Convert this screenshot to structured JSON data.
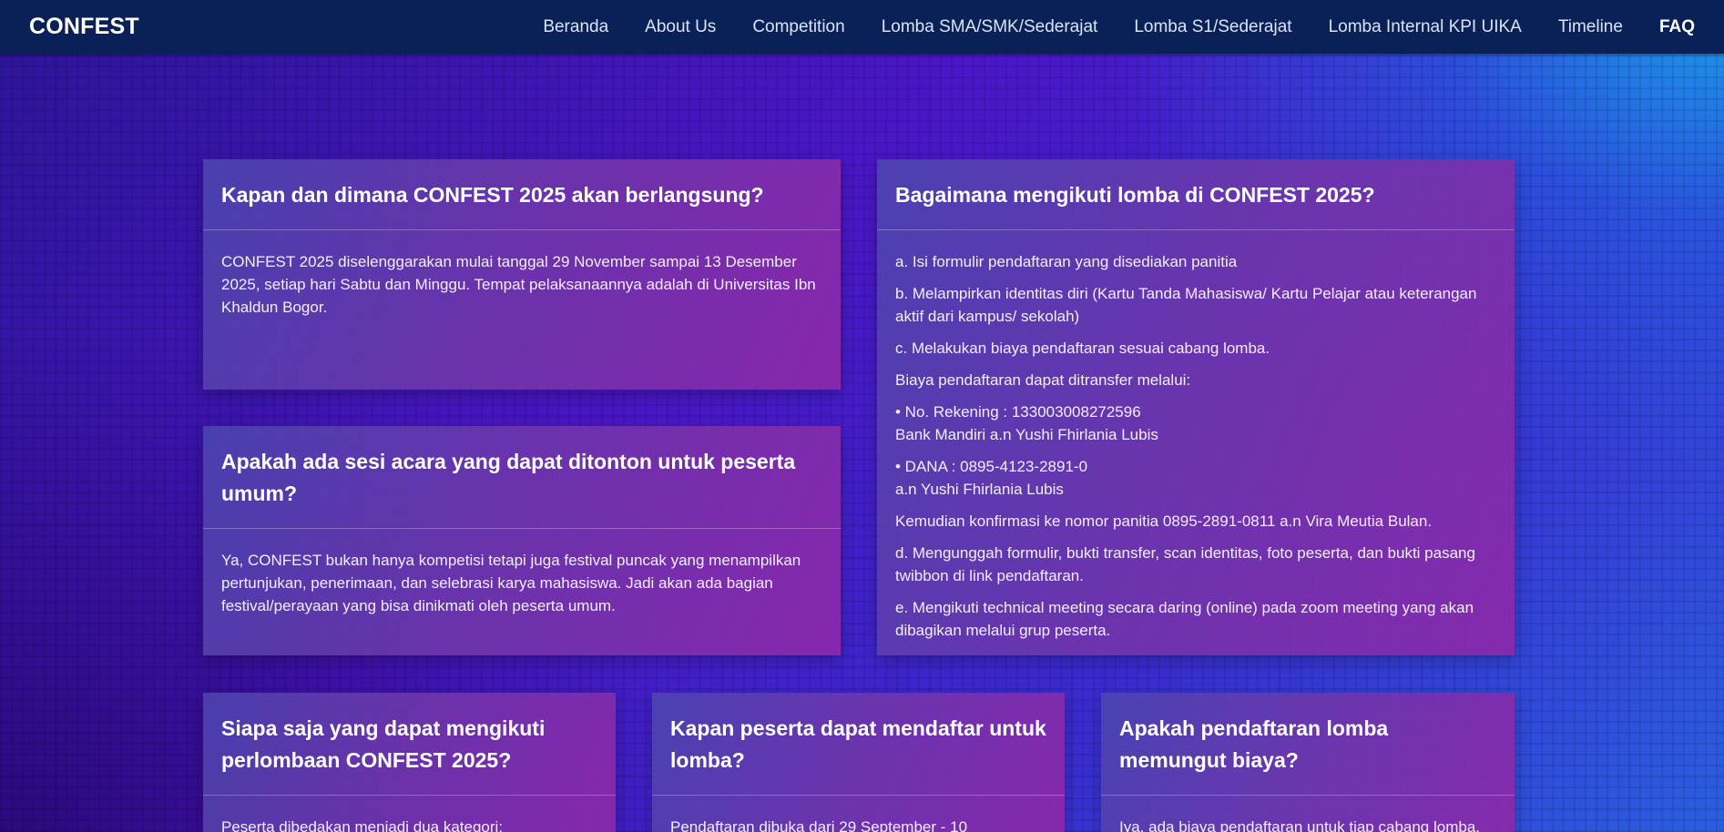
{
  "nav": {
    "brand": "CONFEST",
    "links": [
      "Beranda",
      "About Us",
      "Competition",
      "Lomba SMA/SMK/Sederajat",
      "Lomba S1/Sederajat",
      "Lomba Internal KPI UIKA",
      "Timeline",
      "FAQ"
    ],
    "active": "FAQ"
  },
  "faq": {
    "when_where": {
      "question": "Kapan dan dimana CONFEST 2025 akan berlangsung?",
      "answer": "CONFEST 2025 diselenggarakan mulai tanggal 29 November sampai 13 Desember 2025, setiap hari Sabtu dan Minggu. Tempat pelaksanaannya adalah di Universitas Ibn Khaldun Bogor."
    },
    "public_session": {
      "question": "Apakah ada sesi acara yang dapat ditonton untuk peserta umum?",
      "answer": "Ya, CONFEST bukan hanya kompetisi tetapi juga festival puncak yang menampilkan pertunjukan, penerimaan, dan selebrasi karya mahasiswa. Jadi akan ada bagian festival/perayaan yang bisa dinikmati oleh peserta umum."
    },
    "how_to_join": {
      "question": "Bagaimana mengikuti lomba di CONFEST 2025?",
      "steps": {
        "a": "a. Isi formulir pendaftaran yang disediakan panitia",
        "b": "b. Melampirkan identitas diri (Kartu Tanda Mahasiswa/ Kartu Pelajar atau keterangan aktif dari kampus/ sekolah)",
        "c": "c. Melakukan biaya pendaftaran sesuai cabang lomba.",
        "transfer_intro": "Biaya pendaftaran dapat ditransfer melalui:",
        "bank_line1": "• No. Rekening : 133003008272596",
        "bank_line2": "Bank Mandiri a.n Yushi Fhirlania Lubis",
        "dana_line1": "• DANA : 0895-4123-2891-0",
        "dana_line2": "a.n Yushi Fhirlania Lubis",
        "confirm": "Kemudian konfirmasi ke nomor panitia 0895-2891-0811 a.n Vira Meutia Bulan.",
        "d": "d. Mengunggah formulir, bukti transfer, scan identitas, foto peserta, dan bukti pasang twibbon di link pendaftaran.",
        "e": "e. Mengikuti technical meeting secara daring (online) pada zoom meeting yang akan dibagikan melalui grup peserta."
      }
    },
    "who_can_join": {
      "question": "Siapa saja yang dapat mengikuti perlombaan CONFEST 2025?",
      "answer": "Peserta dibedakan menjadi dua kategori:"
    },
    "registration_date": {
      "question": "Kapan peserta dapat mendaftar untuk lomba?",
      "answer": "Pendaftaran dibuka dari 29 September - 10"
    },
    "fee": {
      "question": "Apakah pendaftaran lomba memungut biaya?",
      "answer": "Iya, ada biaya pendaftaran untuk tiap cabang lomba."
    }
  }
}
